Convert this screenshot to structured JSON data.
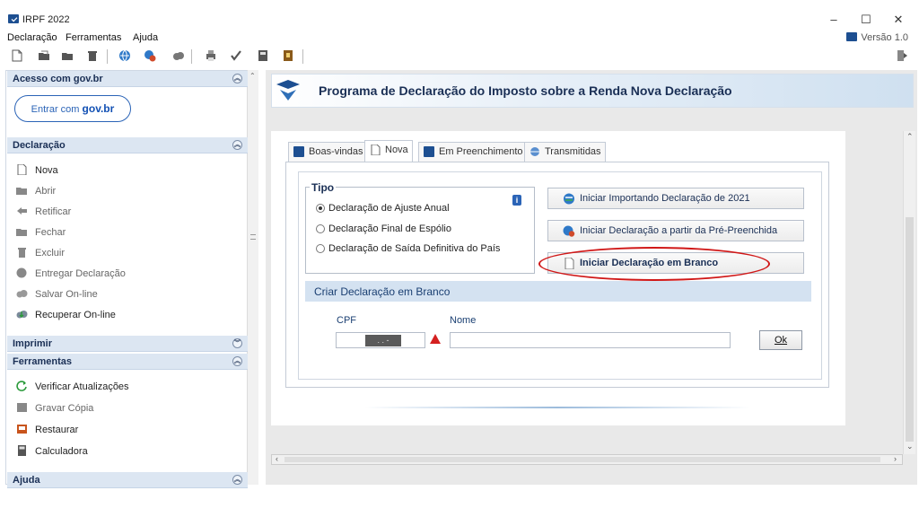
{
  "window": {
    "title": "IRPF 2022",
    "minimize": "–",
    "maximize": "☐",
    "close": "✕"
  },
  "menu": {
    "items": [
      "Declaração",
      "Ferramentas",
      "Ajuda"
    ],
    "version": "Versão 1.0"
  },
  "toolbar": {
    "icons": [
      "new-file-icon",
      "open-folder-icon",
      "folder-icon",
      "trash-icon",
      "globe-icon",
      "globe-user-icon",
      "cloud-icon",
      "print-icon",
      "check-icon",
      "calculator-icon",
      "book-icon"
    ]
  },
  "sidebar": {
    "acesso": {
      "title": "Acesso com gov.br",
      "button_prefix": "Entrar com",
      "button_brand": "gov.br"
    },
    "declaracao": {
      "title": "Declaração",
      "items": [
        "Nova",
        "Abrir",
        "Retificar",
        "Fechar",
        "Excluir",
        "Entregar Declaração",
        "Salvar On-line",
        "Recuperar On-line"
      ]
    },
    "imprimir": {
      "title": "Imprimir"
    },
    "ferramentas": {
      "title": "Ferramentas",
      "items": [
        "Verificar Atualizações",
        "Gravar Cópia",
        "Restaurar",
        "Calculadora"
      ]
    },
    "ajuda": {
      "title": "Ajuda"
    }
  },
  "header": {
    "title": "Programa de Declaração do Imposto sobre a Renda Nova Declaração"
  },
  "tabs": [
    "Boas-vindas",
    "Nova",
    "Em Preenchimento",
    "Transmitidas"
  ],
  "tipo": {
    "legend": "Tipo",
    "options": [
      "Declaração de Ajuste Anual",
      "Declaração Final de Espólio",
      "Declaração de Saída Definitiva do País"
    ],
    "selected_index": 0
  },
  "actions": [
    "Iniciar Importando Declaração de 2021",
    "Iniciar Declaração a partir da Pré-Preenchida",
    "Iniciar Declaração em Branco"
  ],
  "criar": {
    "title": "Criar Declaração em Branco",
    "cpf_label": "CPF",
    "nome_label": "Nome",
    "cpf_value": ". . -",
    "nome_value": "",
    "ok_label": "Ok"
  },
  "colors": {
    "accent": "#1d4f91",
    "highlight": "#d01818",
    "section_bg": "#dce6f2"
  }
}
